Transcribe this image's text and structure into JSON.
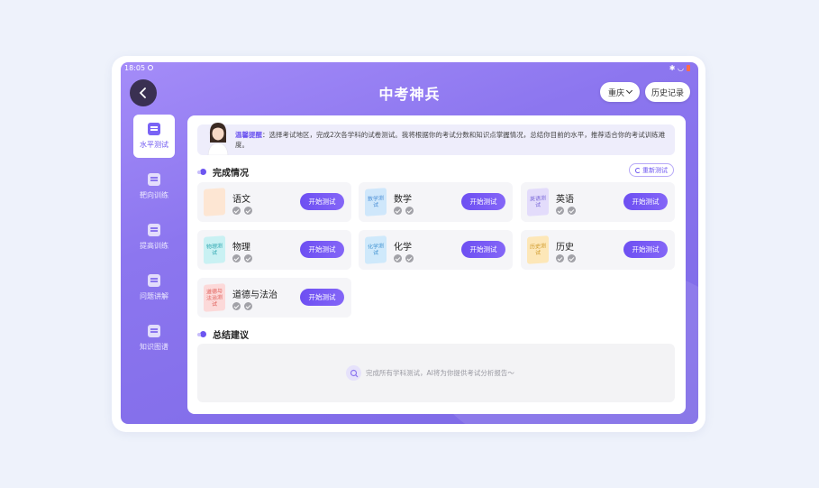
{
  "status_bar": {
    "time": "18:05"
  },
  "header": {
    "title": "中考神兵",
    "region": "重庆",
    "history": "历史记录"
  },
  "sidebar": {
    "items": [
      {
        "label": "水平测试",
        "icon": "level-test-icon",
        "active": true
      },
      {
        "label": "靶向训练",
        "icon": "target-training-icon"
      },
      {
        "label": "提高训练",
        "icon": "improve-training-icon"
      },
      {
        "label": "问题讲解",
        "icon": "question-explain-icon"
      },
      {
        "label": "知识图谱",
        "icon": "knowledge-graph-icon"
      }
    ]
  },
  "notice": {
    "prefix": "温馨提醒",
    "text": "：选择考试地区，完成2次各学科的试卷测试。我将根据你的考试分数和知识点掌握情况，总结你目前的水平，推荐适合你的考试训练难度。"
  },
  "completion": {
    "title": "完成情况",
    "retest": "重新测试",
    "start_label": "开始测试",
    "subjects": [
      {
        "name": "语文",
        "book": "",
        "color": "#fde6d3",
        "text_color": "#e39a5a"
      },
      {
        "name": "数学",
        "book": "数学测试",
        "color": "#cfe7fb",
        "text_color": "#4b8fd6"
      },
      {
        "name": "英语",
        "book": "英语测试",
        "color": "#e3dcfb",
        "text_color": "#7a68d9"
      },
      {
        "name": "物理",
        "book": "物理测试",
        "color": "#c9f1f3",
        "text_color": "#2fa7b1"
      },
      {
        "name": "化学",
        "book": "化学测试",
        "color": "#cfe9fb",
        "text_color": "#3f92d1"
      },
      {
        "name": "历史",
        "book": "历史测试",
        "color": "#fde7b8",
        "text_color": "#cf9a2a"
      },
      {
        "name": "道德与法治",
        "book": "道德与法治测试",
        "color": "#fcd9d9",
        "text_color": "#e0605a"
      }
    ]
  },
  "summary": {
    "title": "总结建议",
    "placeholder": "完成所有学科测试，AI将为你提供考试分析报告～"
  },
  "colors": {
    "accent": "#6c55f0",
    "header_bg": "#8c76ef"
  }
}
